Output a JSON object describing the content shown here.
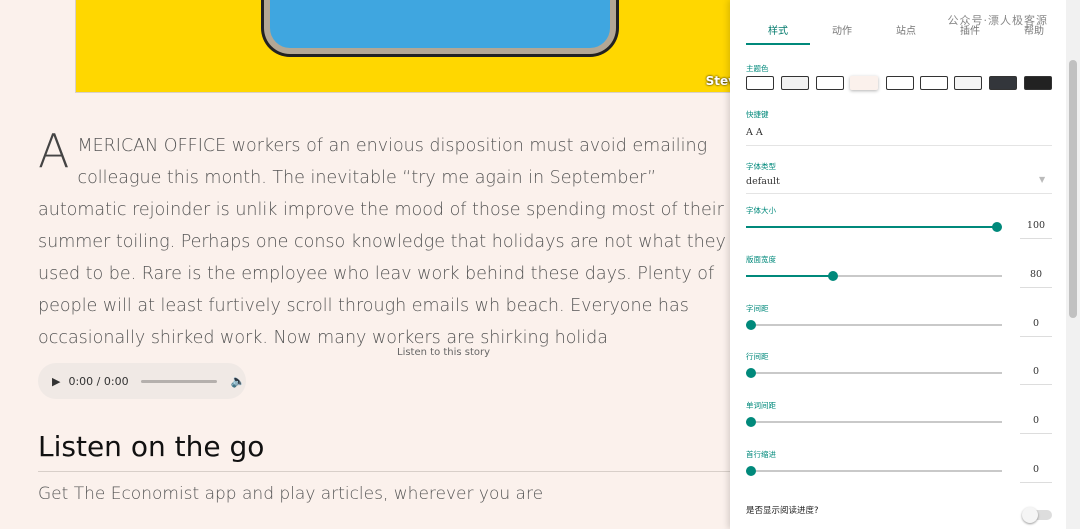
{
  "hero": {
    "caption": "Stev"
  },
  "article": {
    "dropcap": "A",
    "paragraph": "MERICAN OFFICE workers of an envious disposition must avoid emailing colleague this month. The inevitable “try me again in September” automatic rejoinder is unlik improve the mood of those spending most of their summer toiling. Perhaps one conso knowledge that holidays are not what they used to be. Rare is the employee who leav work behind these days. Plenty of people will at least furtively scroll through emails wh beach. Everyone has occasionally shirked work. Now many workers are shirking holida",
    "listen_label": "Listen to this story",
    "audio": {
      "time": "0:00 / 0:00"
    },
    "section_title": "Listen on the go",
    "section_sub": "Get The Economist app and play articles, wherever you are"
  },
  "panel": {
    "watermark": "公众号·漂人极客源",
    "tabs": [
      "样式",
      "动作",
      "站点",
      "插件",
      "帮助"
    ],
    "theme_label": "主题色",
    "theme_colors": [
      "#ffffff",
      "#f2f2f2",
      "#ffffff",
      "#fbf1ec",
      "#ffffff",
      "#ffffff",
      "#f4f4f4",
      "#33363b",
      "#222222"
    ],
    "hotkey_label": "快捷键",
    "hotkey_value": "A A",
    "font_label": "字体类型",
    "font_value": "default",
    "sliders": [
      {
        "label": "字体大小",
        "value": "100",
        "fraction": 0.98
      },
      {
        "label": "版面宽度",
        "value": "80",
        "fraction": 0.34
      },
      {
        "label": "字间距",
        "value": "0",
        "fraction": 0
      },
      {
        "label": "行间距",
        "value": "0",
        "fraction": 0
      },
      {
        "label": "单词间距",
        "value": "0",
        "fraction": 0
      },
      {
        "label": "首行缩进",
        "value": "0",
        "fraction": 0
      }
    ],
    "progress_question": "是否显示阅读进度?",
    "accent": "#00897b"
  }
}
